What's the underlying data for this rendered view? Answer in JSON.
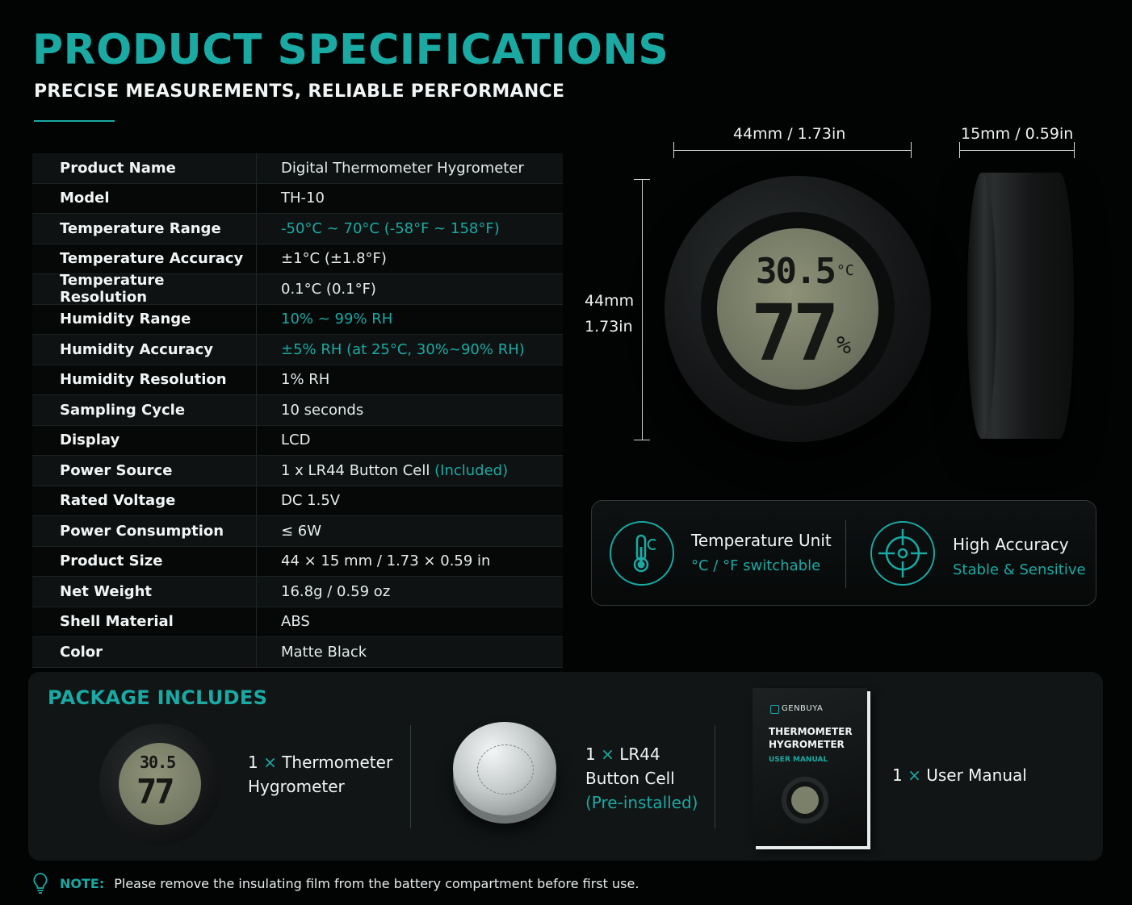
{
  "header": {
    "title": "PRODUCT SPECIFICATIONS",
    "subtitle": "PRECISE MEASUREMENTS, RELIABLE PERFORMANCE"
  },
  "specs": [
    {
      "label": "Product Name",
      "value": "Digital Thermometer Hygrometer"
    },
    {
      "label": "Model",
      "value": "TH-10"
    },
    {
      "label": "Temperature Range",
      "value": "-50°C ~ 70°C (-58°F ~ 158°F)"
    },
    {
      "label": "Temperature Accuracy",
      "value": "±1°C (±1.8°F)"
    },
    {
      "label": "Temperature Resolution",
      "value": "0.1°C (0.1°F)"
    },
    {
      "label": "Humidity Range",
      "value": "10% ~ 99% RH"
    },
    {
      "label": "Humidity Accuracy",
      "value": "±5% RH (at 25°C, 30%~90% RH)"
    },
    {
      "label": "Humidity Resolution",
      "value": "1% RH"
    },
    {
      "label": "Sampling Cycle",
      "value": "10 seconds"
    },
    {
      "label": "Display",
      "value": "LCD"
    },
    {
      "label": "Power Source",
      "value": "1 x LR44 Button Cell",
      "extra": "(Included)"
    },
    {
      "label": "Rated Voltage",
      "value": "DC 1.5V"
    },
    {
      "label": "Power Consumption",
      "value": "≤ 6W"
    },
    {
      "label": "Product Size",
      "value": "44 × 15 mm / 1.73 × 0.59 in"
    },
    {
      "label": "Net Weight",
      "value": "16.8g / 0.59 oz"
    },
    {
      "label": "Shell Material",
      "value": "ABS"
    },
    {
      "label": "Color",
      "value": "Matte Black"
    }
  ],
  "dimensions": {
    "width": "44mm / 1.73in",
    "depth": "15mm / 0.59in",
    "height_mm": "44mm",
    "height_in": "1.73in"
  },
  "lcd": {
    "temp": "30.5",
    "temp_unit": "°C",
    "humidity": "77",
    "humidity_unit": "%"
  },
  "features": [
    {
      "title": "Temperature Unit",
      "sub": "°C / °F switchable",
      "icon": "thermometer-celsius-icon"
    },
    {
      "title": "High Accuracy",
      "sub": "Stable & Sensitive",
      "icon": "target-crosshair-icon"
    }
  ],
  "package": {
    "title": "PACKAGE INCLUDES",
    "items": [
      {
        "qty": "1",
        "x": "×",
        "line1": "Thermometer",
        "line2": "Hygrometer"
      },
      {
        "qty": "1",
        "x": "×",
        "line1": "LR44",
        "line2": "Button Cell",
        "line3": "(Pre-installed)"
      },
      {
        "qty": "1",
        "x": "×",
        "line1": "User Manual"
      }
    ],
    "manual": {
      "brand": "GENBUYA",
      "title1": "THERMOMETER",
      "title2": "HYGROMETER",
      "sub": "USER MANUAL"
    }
  },
  "note": {
    "label": "NOTE:",
    "text": "Please remove the insulating film from the battery compartment before first use."
  },
  "colors": {
    "accent": "#1aa9a3",
    "background": "#020303"
  }
}
